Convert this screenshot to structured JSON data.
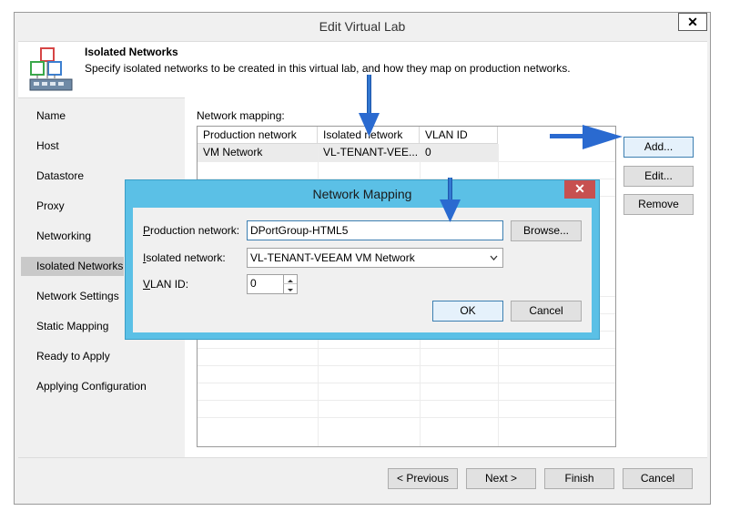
{
  "window": {
    "title": "Edit Virtual Lab",
    "close_glyph": "✕"
  },
  "header": {
    "title": "Isolated Networks",
    "description": "Specify isolated networks to be created in this virtual lab, and how they map on production networks.",
    "icon": "network-topology-icon"
  },
  "nav": {
    "items": [
      {
        "label": "Name"
      },
      {
        "label": "Host"
      },
      {
        "label": "Datastore"
      },
      {
        "label": "Proxy"
      },
      {
        "label": "Networking"
      },
      {
        "label": "Isolated Networks",
        "active": true
      },
      {
        "label": "Network Settings"
      },
      {
        "label": "Static Mapping"
      },
      {
        "label": "Ready to Apply"
      },
      {
        "label": "Applying Configuration"
      }
    ]
  },
  "mapping": {
    "label": "Network mapping:",
    "columns": [
      "Production network",
      "Isolated network",
      "VLAN ID"
    ],
    "rows": [
      {
        "production": "VM Network",
        "isolated": "VL-TENANT-VEE...",
        "vlan": "0"
      }
    ]
  },
  "side_buttons": {
    "add": "Add...",
    "edit": "Edit...",
    "remove": "Remove"
  },
  "footer": {
    "previous": "< Previous",
    "next": "Next >",
    "finish": "Finish",
    "cancel": "Cancel"
  },
  "dialog": {
    "title": "Network Mapping",
    "close_glyph": "✕",
    "production_label_first": "P",
    "production_label_rest": "roduction network:",
    "production_value": "DPortGroup-HTML5",
    "browse": "Browse...",
    "isolated_label_first": "I",
    "isolated_label_rest": "solated network:",
    "isolated_value": "VL-TENANT-VEEAM VM Network",
    "vlan_label_first": "V",
    "vlan_label_rest": "LAN ID:",
    "vlan_value": "0",
    "ok": "OK",
    "cancel": "Cancel"
  },
  "annotations": {
    "arrow_color": "#1f5fbf"
  }
}
